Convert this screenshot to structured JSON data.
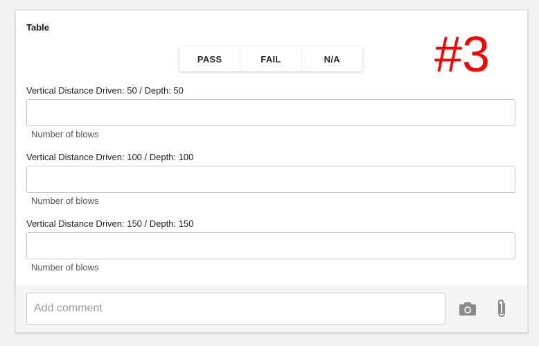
{
  "section": {
    "title": "Table",
    "marker": "#3"
  },
  "toggle": {
    "options": [
      "PASS",
      "FAIL",
      "N/A"
    ]
  },
  "fields": [
    {
      "label": "Vertical Distance Driven: 50 / Depth: 50",
      "value": "",
      "hint": "Number of blows"
    },
    {
      "label": "Vertical Distance Driven: 100 / Depth: 100",
      "value": "",
      "hint": "Number of blows"
    },
    {
      "label": "Vertical Distance Driven: 150 / Depth: 150",
      "value": "",
      "hint": "Number of blows"
    }
  ],
  "footer": {
    "comment_placeholder": "Add comment",
    "icons": [
      "camera-icon",
      "paperclip-icon"
    ]
  },
  "colors": {
    "marker": "#ff0000",
    "icon": "#8a8a8a"
  }
}
